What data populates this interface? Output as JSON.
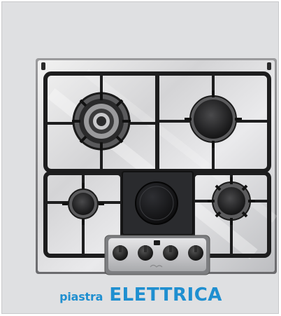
{
  "image": {
    "subject": "gas-hob-with-electric-plate",
    "background_color": "#dfe0e2"
  },
  "caption": {
    "prefix": "piastra",
    "main": "ELETTRICA",
    "color": "#1f8fd0"
  },
  "hob": {
    "burners": [
      {
        "kind": "triple-crown-burner",
        "position_name": "top-left"
      },
      {
        "kind": "large-burner",
        "position_name": "top-right"
      },
      {
        "kind": "small-burner",
        "position_name": "bottom-left"
      },
      {
        "kind": "electric-hotplate",
        "position_name": "bottom-center"
      },
      {
        "kind": "medium-burner",
        "position_name": "bottom-right"
      }
    ],
    "knob_count": 4,
    "materials": [
      "stainless-steel",
      "cast-iron-grates"
    ]
  }
}
